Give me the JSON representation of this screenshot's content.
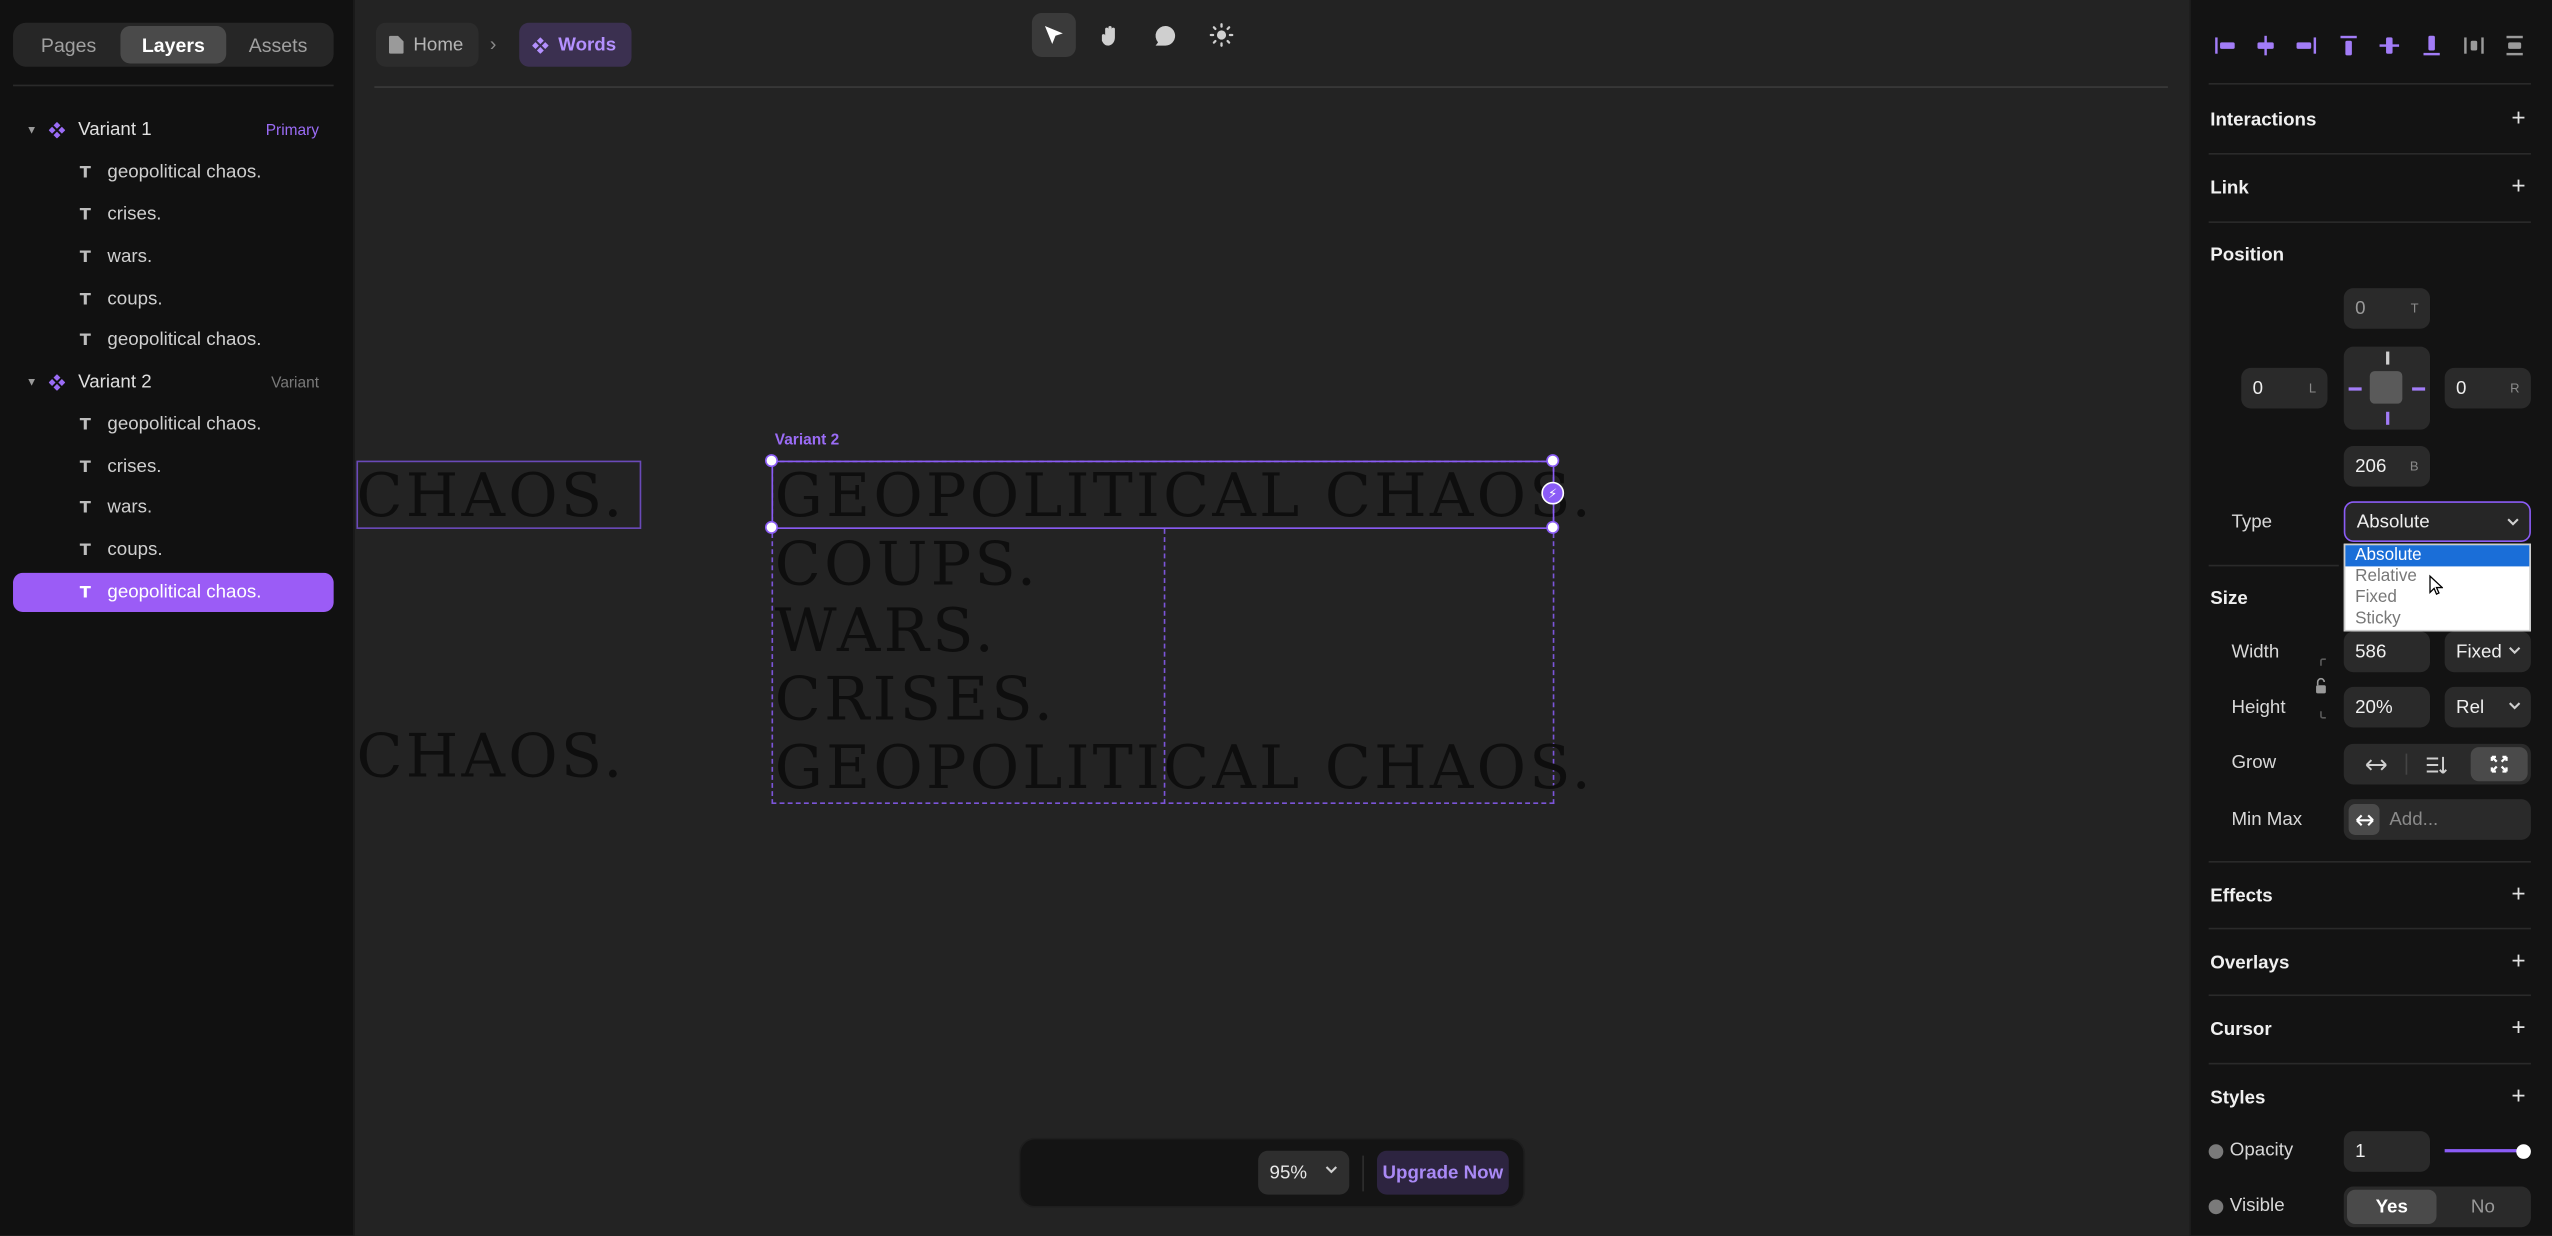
{
  "left_panel": {
    "tabs": [
      "Pages",
      "Layers",
      "Assets"
    ],
    "active_tab": "Layers",
    "variants": [
      {
        "name": "Variant 1",
        "tag": "Primary",
        "tag_color": "#9b6cf6",
        "children": [
          "geopolitical chaos.",
          "crises.",
          "wars.",
          "coups.",
          "geopolitical chaos."
        ]
      },
      {
        "name": "Variant 2",
        "tag": "Variant",
        "tag_color": "#7a7a7a",
        "children": [
          "geopolitical chaos.",
          "crises.",
          "wars.",
          "coups.",
          "geopolitical chaos."
        ]
      }
    ],
    "selected_layer": "geopolitical chaos."
  },
  "breadcrumb": {
    "home": "Home",
    "current": "Words"
  },
  "canvas": {
    "frame_label": "Variant 2",
    "left_fragment_top": "CHAOS.",
    "left_fragment_bottom": "CHAOS.",
    "lines": [
      "GEOPOLITICAL CHAOS.",
      "COUPS.",
      "WARS.",
      "CRISES.",
      "GEOPOLITICAL CHAOS."
    ]
  },
  "toolbar": {
    "zoom": "95%",
    "upgrade": "Upgrade Now"
  },
  "right_panel": {
    "interactions": "Interactions",
    "link": "Link",
    "position": {
      "title": "Position",
      "top": "0",
      "top_suffix": "T",
      "left": "0",
      "left_suffix": "L",
      "right": "0",
      "right_suffix": "R",
      "bottom": "206",
      "bottom_suffix": "B",
      "type_label": "Type",
      "type_value": "Absolute",
      "type_options": [
        "Absolute",
        "Relative",
        "Fixed",
        "Sticky"
      ]
    },
    "size": {
      "title": "Size",
      "width_label": "Width",
      "width_value": "586",
      "width_mode": "Fixed",
      "height_label": "Height",
      "height_value": "20%",
      "height_mode": "Rel",
      "grow_label": "Grow",
      "minmax_label": "Min Max",
      "minmax_placeholder": "Add..."
    },
    "effects": "Effects",
    "overlays": "Overlays",
    "cursor": "Cursor",
    "styles": {
      "title": "Styles",
      "opacity_label": "Opacity",
      "opacity_value": "1",
      "visible_label": "Visible",
      "visible_yes": "Yes",
      "visible_no": "No"
    }
  },
  "colors": {
    "accent": "#8b5cf6",
    "selected_row": "#9b5cf6"
  }
}
